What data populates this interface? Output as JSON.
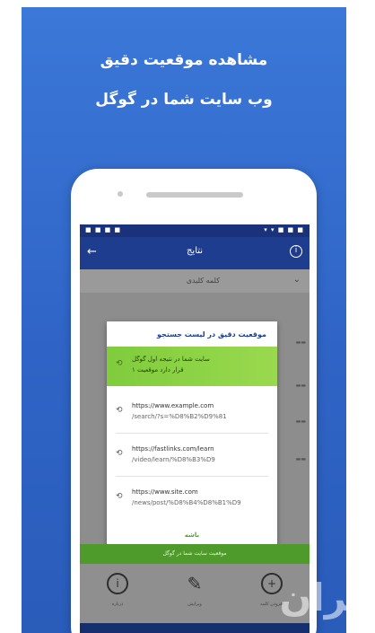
{
  "headline": {
    "line1": "مشاهده موقعیت دقیق",
    "line2": "وب سایت شما در گوگل"
  },
  "status_bar": {
    "left": "■ ■ ■ ■",
    "right": "▾ ▾ ■ ■ ■"
  },
  "app_bar": {
    "title": "نتایج",
    "back_icon": "back-arrow-icon",
    "info_icon": "info-icon"
  },
  "subheader": {
    "label": "کلمه کلیدی",
    "chevron_icon": "chevron-down-icon"
  },
  "dialog": {
    "title": "موقعیت دقیق در لیست جستجو",
    "items": [
      {
        "icon": "link-icon",
        "line1": "سایت شما در نتیجه اول گوگل",
        "line2": "قرار دارد موقعیت ۱"
      },
      {
        "icon": "link-icon",
        "line1": "https://www.example.com",
        "line2": "/search/?s=%D8%B2%D9%81"
      },
      {
        "icon": "link-icon",
        "line1": "https://fastlinks.com/learn",
        "line2": "/video/learn/%D8%B3%D9"
      },
      {
        "icon": "link-icon",
        "line1": "https://www.site.com",
        "line2": "/news/post/%D8%B4%D8%B1%D9"
      }
    ],
    "ok_label": "باشه"
  },
  "green_bar_text": "موقعیت سایت شما در گوگل",
  "tabs": [
    {
      "icon": "info-circle-icon",
      "label": "درباره"
    },
    {
      "icon": "pencil-icon",
      "label": "ویرایش"
    },
    {
      "icon": "add-circle-icon",
      "label": "افزودن کلمه"
    }
  ],
  "nav": {
    "back": "◁",
    "home": "○",
    "recent": "□"
  },
  "watermark": "ایران",
  "colors": {
    "promo_background": "#3068cc",
    "app_bar": "#1f3d8f",
    "highlight_green": "#8dd245",
    "green_bar": "#4e9a2b"
  }
}
